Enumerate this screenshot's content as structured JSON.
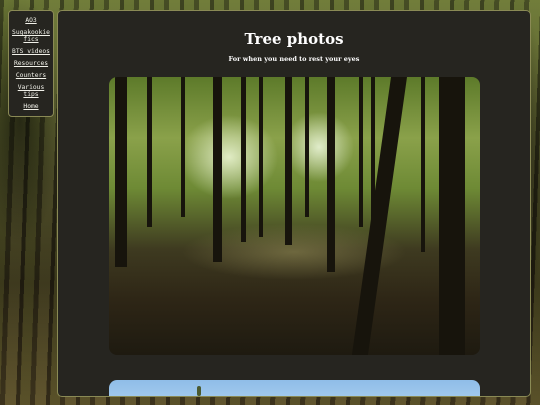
{
  "nav": {
    "items": [
      "AO3",
      "Sugakookie fics",
      "BTS videos",
      "Resources",
      "Counters",
      "Various tips",
      "Home"
    ]
  },
  "page": {
    "title": "Tree photos",
    "subtitle": "For when you need to rest your eyes"
  },
  "colors": {
    "panel_bg": "#262520",
    "border": "#8a8a55",
    "text": "#ffffff"
  }
}
